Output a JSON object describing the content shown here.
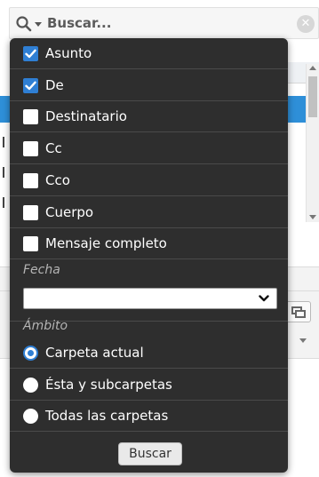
{
  "search": {
    "placeholder": "Buscar..."
  },
  "menu": {
    "fields": [
      {
        "label": "Asunto",
        "checked": true
      },
      {
        "label": "De",
        "checked": true
      },
      {
        "label": "Destinatario",
        "checked": false
      },
      {
        "label": "Cc",
        "checked": false
      },
      {
        "label": "Cco",
        "checked": false
      },
      {
        "label": "Cuerpo",
        "checked": false
      },
      {
        "label": "Mensaje completo",
        "checked": false
      }
    ],
    "date_section": "Fecha",
    "date_value": "",
    "scope_section": "Ámbito",
    "scopes": [
      {
        "label": "Carpeta actual",
        "selected": true
      },
      {
        "label": "Ésta y subcarpetas",
        "selected": false
      },
      {
        "label": "Todas las carpetas",
        "selected": false
      }
    ],
    "search_button": "Buscar"
  },
  "colors": {
    "accent": "#2f7fd4",
    "menu_bg": "#2e2e2e",
    "selection": "#2e8fd8"
  },
  "icons": {
    "search": "magnifier-icon",
    "clear": "clear-circle-icon",
    "caret": "caret-down-icon"
  }
}
